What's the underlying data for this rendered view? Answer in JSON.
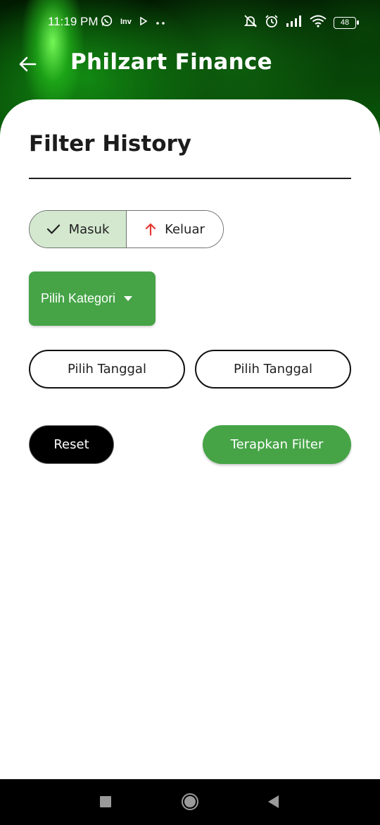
{
  "status_bar": {
    "time": "11:19 PM",
    "notification_icons": [
      "whatsapp-icon",
      "inv-app-icon",
      "play-icon",
      "more-dots-icon"
    ],
    "inv_label": "Inv",
    "battery_level": "48",
    "right_icons": [
      "bell-muted-icon",
      "alarm-icon",
      "signal-icon",
      "wifi-icon",
      "battery-icon"
    ]
  },
  "app_bar": {
    "title": "Philzart Finance",
    "back_icon": "arrow-left-icon"
  },
  "filter": {
    "title": "Filter History",
    "type_toggle": {
      "masuk_label": "Masuk",
      "masuk_icon": "check-icon",
      "keluar_label": "Keluar",
      "keluar_icon": "arrow-up-icon",
      "selected": "Masuk"
    },
    "category_button": "Pilih Kategori",
    "start_date_button": "Pilih Tanggal",
    "end_date_button": "Pilih Tanggal",
    "reset_button": "Reset",
    "apply_button": "Terapkan Filter"
  },
  "colors": {
    "accent_green": "#46a447",
    "selected_segment": "#d3e8cf",
    "keluar_arrow": "#e53935",
    "reset_bg": "#000000"
  },
  "nav_bar": {
    "buttons": [
      "recent-apps-icon",
      "home-icon",
      "back-triangle-icon"
    ]
  }
}
